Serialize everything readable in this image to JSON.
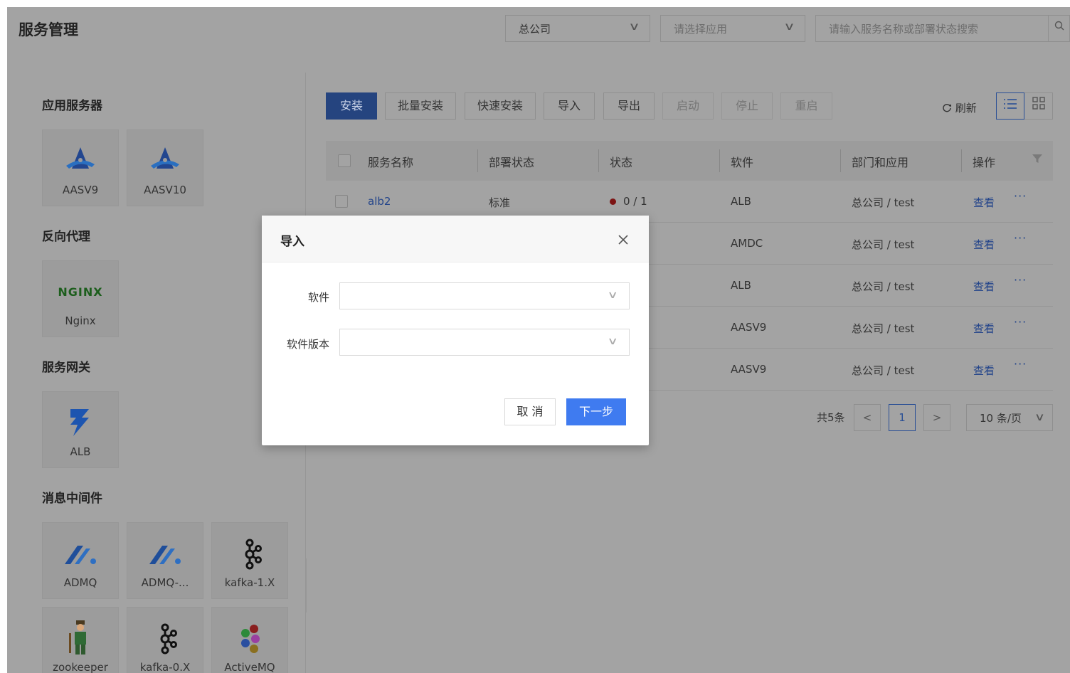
{
  "header": {
    "title": "服务管理",
    "company_select": "总公司",
    "app_select_placeholder": "请选择应用",
    "search_placeholder": "请输入服务名称或部署状态搜索"
  },
  "sidebar": {
    "sections": [
      {
        "title": "应用服务器",
        "items": [
          {
            "label": "AASV9",
            "icon": "aas-logo-icon"
          },
          {
            "label": "AASV10",
            "icon": "aas-logo-icon"
          }
        ]
      },
      {
        "title": "反向代理",
        "items": [
          {
            "label": "Nginx",
            "icon": "nginx-logo-icon",
            "logo_text": "NGINX"
          }
        ]
      },
      {
        "title": "服务网关",
        "items": [
          {
            "label": "ALB",
            "icon": "alb-logo-icon"
          }
        ]
      },
      {
        "title": "消息中间件",
        "items": [
          {
            "label": "ADMQ",
            "icon": "admq-logo-icon"
          },
          {
            "label": "ADMQ-...",
            "icon": "admq-logo-icon"
          },
          {
            "label": "kafka-1.X",
            "icon": "kafka-logo-icon"
          },
          {
            "label": "zookeeper",
            "icon": "zookeeper-logo-icon"
          },
          {
            "label": "kafka-0.X",
            "icon": "kafka-logo-icon"
          },
          {
            "label": "ActiveMQ",
            "icon": "activemq-logo-icon"
          }
        ]
      }
    ]
  },
  "toolbar": {
    "install": "安装",
    "batch_install": "批量安装",
    "quick_install": "快速安装",
    "import": "导入",
    "export": "导出",
    "start": "启动",
    "stop": "停止",
    "restart": "重启",
    "refresh": "刷新"
  },
  "table": {
    "columns": [
      "服务名称",
      "部署状态",
      "状态",
      "软件",
      "部门和应用",
      "操作"
    ],
    "rows": [
      {
        "name": "alb2",
        "deploy_status": "标准",
        "status": "0 / 1",
        "software": "ALB",
        "dept": "总公司 / test",
        "action": "查看"
      },
      {
        "name": "",
        "deploy_status": "",
        "status": "",
        "software": "AMDC",
        "dept": "总公司 / test",
        "action": "查看"
      },
      {
        "name": "",
        "deploy_status": "",
        "status": "",
        "software": "ALB",
        "dept": "总公司 / test",
        "action": "查看"
      },
      {
        "name": "",
        "deploy_status": "",
        "status": "",
        "software": "AASV9",
        "dept": "总公司 / test",
        "action": "查看"
      },
      {
        "name": "",
        "deploy_status": "",
        "status": "",
        "software": "AASV9",
        "dept": "总公司 / test",
        "action": "查看"
      }
    ],
    "more_label": "···"
  },
  "pagination": {
    "total": "共5条",
    "current_page": "1",
    "prev": "<",
    "next": ">",
    "page_size": "10 条/页"
  },
  "modal": {
    "title": "导入",
    "software_label": "软件",
    "software_version_label": "软件版本",
    "cancel": "取 消",
    "next": "下一步"
  },
  "colors": {
    "primary": "#3f7bf0",
    "link": "#23448a",
    "status_error": "#7d1414"
  }
}
